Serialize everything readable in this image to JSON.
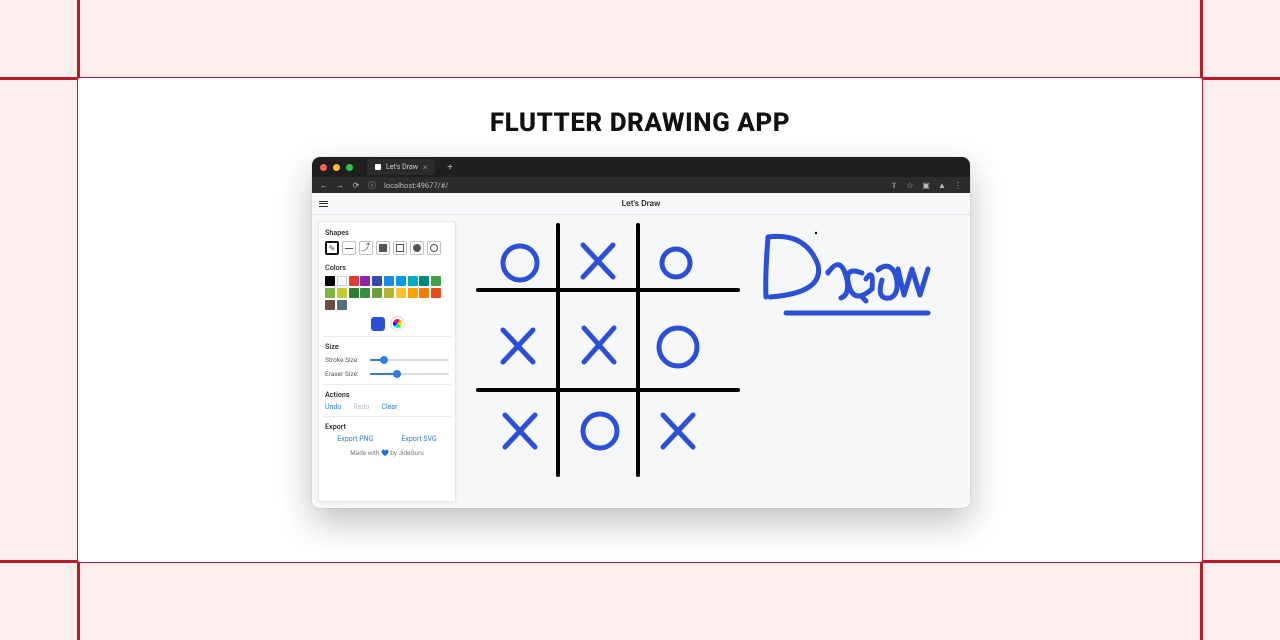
{
  "page": {
    "title": "FLUTTER DRAWING APP"
  },
  "browser": {
    "tab_title": "Let's Draw",
    "url": "localhost:49677/#/"
  },
  "app": {
    "title": "Let's Draw"
  },
  "sidebar": {
    "shapes_label": "Shapes",
    "shapes": [
      {
        "id": "pencil",
        "name": "pencil-icon",
        "active": true
      },
      {
        "id": "line",
        "name": "line-icon"
      },
      {
        "id": "arrow",
        "name": "arrow-icon"
      },
      {
        "id": "rect-filled",
        "name": "square-filled-icon"
      },
      {
        "id": "rect-outline",
        "name": "square-outline-icon"
      },
      {
        "id": "circle-filled",
        "name": "circle-filled-icon"
      },
      {
        "id": "circle-outline",
        "name": "circle-outline-icon"
      }
    ],
    "colors_label": "Colors",
    "swatches": [
      "#000000",
      "#ffffff",
      "#e53935",
      "#8e24aa",
      "#3949ab",
      "#1e88e5",
      "#039be5",
      "#00acc1",
      "#00897b",
      "#43a047",
      "#7cb342",
      "#c0ca33",
      "#2e7d32",
      "#388e3c",
      "#689f38",
      "#afb42b",
      "#fbc02d",
      "#ffa000",
      "#f57c00",
      "#e64a19",
      "#6d4c41",
      "#546e7a"
    ],
    "current_color": "#2b4fd6",
    "size_label": "Size",
    "stroke_label": "Stroke Size:",
    "eraser_label": "Eraser Size:",
    "stroke_value_pct": 18,
    "eraser_value_pct": 34,
    "actions_label": "Actions",
    "undo": "Undo",
    "redo": "Redo",
    "clear": "Clear",
    "redo_enabled": false,
    "export_label": "Export",
    "export_png": "Export PNG",
    "export_svg": "Export SVG",
    "footer_prefix": "Made with ",
    "footer_by": " by ",
    "footer_author": "JideGuru"
  }
}
